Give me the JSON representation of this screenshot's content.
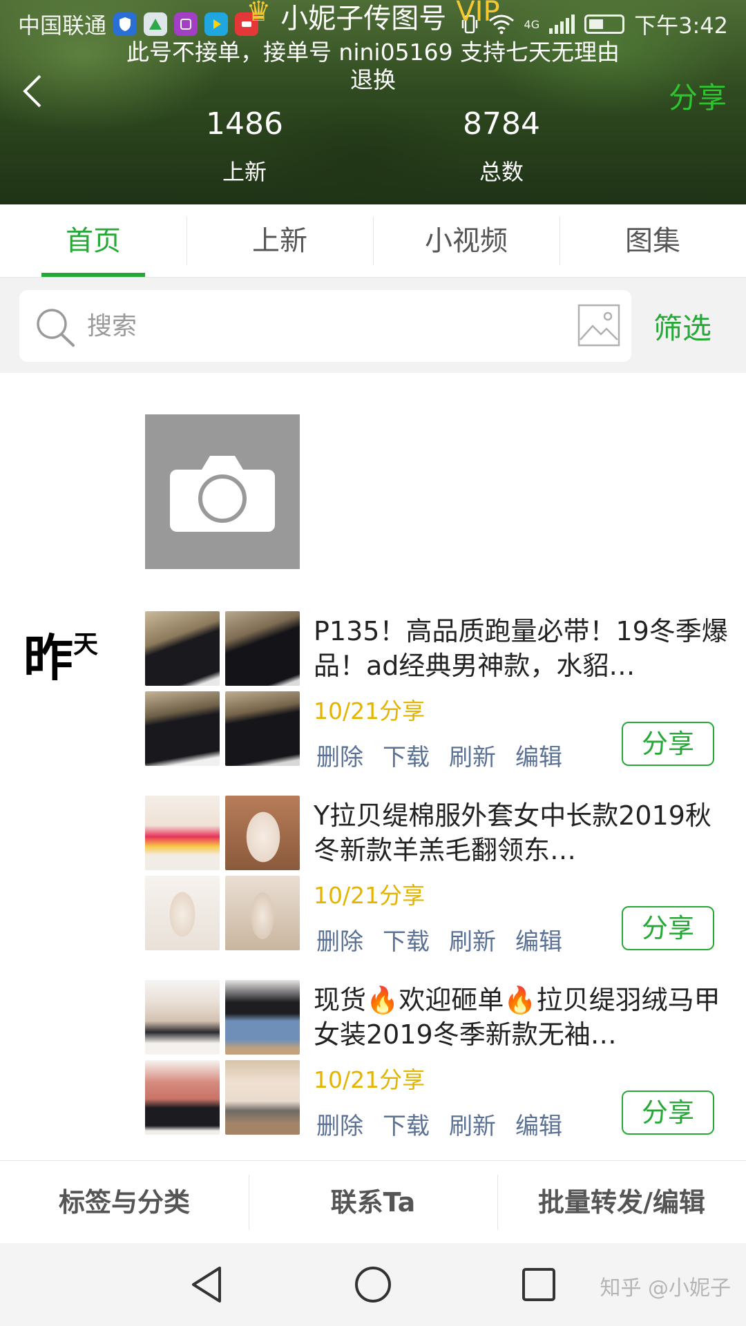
{
  "status_bar": {
    "carrier": "中国联通",
    "network": "4G",
    "time": "下午3:42"
  },
  "header": {
    "shop_name": "小妮子传图号",
    "badge": "VIP",
    "notice": "此号不接单，接单号 nini05169 支持七天无理由退换",
    "share_label": "分享",
    "stats": [
      {
        "value": "1486",
        "label": "上新"
      },
      {
        "value": "8784",
        "label": "总数"
      }
    ]
  },
  "tabs": [
    {
      "label": "首页",
      "active": true
    },
    {
      "label": "上新",
      "active": false
    },
    {
      "label": "小视频",
      "active": false
    },
    {
      "label": "图集",
      "active": false
    }
  ],
  "search": {
    "placeholder": "搜索",
    "filter_label": "筛选"
  },
  "feed": {
    "date_big": "昨",
    "date_small": "天",
    "posts": [
      {
        "title": "P135！高品质跑量必带！19冬季爆品！ad经典男神款，水貂…",
        "date": "10/21分享",
        "actions": [
          "删除",
          "下载",
          "刷新",
          "编辑"
        ],
        "share_label": "分享"
      },
      {
        "title": "Y拉贝缇棉服外套女中长款2019秋冬新款羊羔毛翻领东…",
        "date": "10/21分享",
        "actions": [
          "删除",
          "下载",
          "刷新",
          "编辑"
        ],
        "share_label": "分享"
      },
      {
        "title": "现货🔥欢迎砸单🔥拉贝缇羽绒马甲女装2019冬季新款无袖…",
        "date": "10/21分享",
        "actions": [
          "删除",
          "下载",
          "刷新",
          "编辑"
        ],
        "share_label": "分享"
      }
    ]
  },
  "bottom_bar": [
    "标签与分类",
    "联系Ta",
    "批量转发/编辑"
  ],
  "watermark": "知乎 @小妮子",
  "colors": {
    "accent_green": "#25a836",
    "date_yellow": "#e4b400",
    "action_blue": "#5a7094"
  }
}
